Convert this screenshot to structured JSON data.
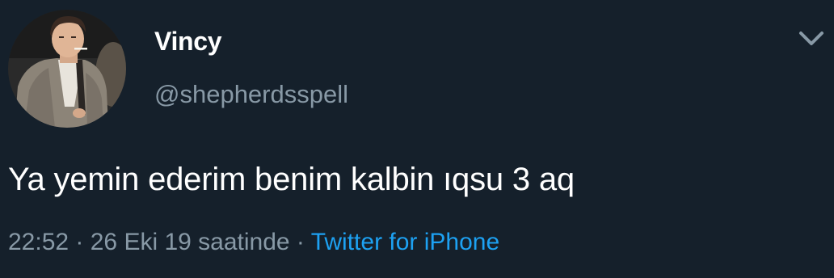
{
  "tweet": {
    "author": {
      "display_name": "Vincy",
      "handle": "@shepherdsspell",
      "avatar_icon": "avatar"
    },
    "menu_icon": "chevron-down-icon",
    "text": "Ya yemin ederim benim kalbin ıqsu 3 aq",
    "timestamp": "22:52 · 26 Eki 19 saatinde",
    "separator": "·",
    "source": "Twitter for iPhone"
  },
  "colors": {
    "background": "#15202b",
    "text_primary": "#ffffff",
    "text_secondary": "#8899a6",
    "accent": "#1da1f2"
  }
}
